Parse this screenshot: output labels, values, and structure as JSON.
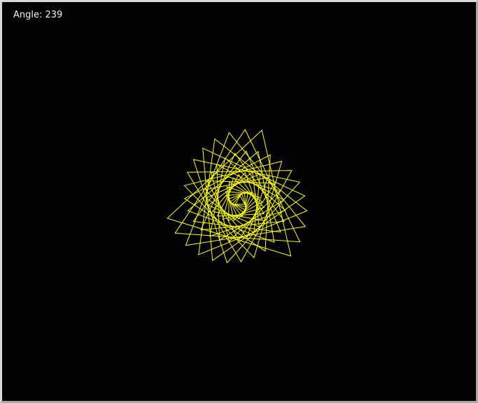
{
  "window": {
    "angle_text": "Angle: 239",
    "colors": {
      "background": "#000000",
      "stroke": "#ffff00",
      "label": "#f2f2f2"
    }
  },
  "figure": {
    "shape": "triangle",
    "count": 30,
    "current_angle": 239
  }
}
